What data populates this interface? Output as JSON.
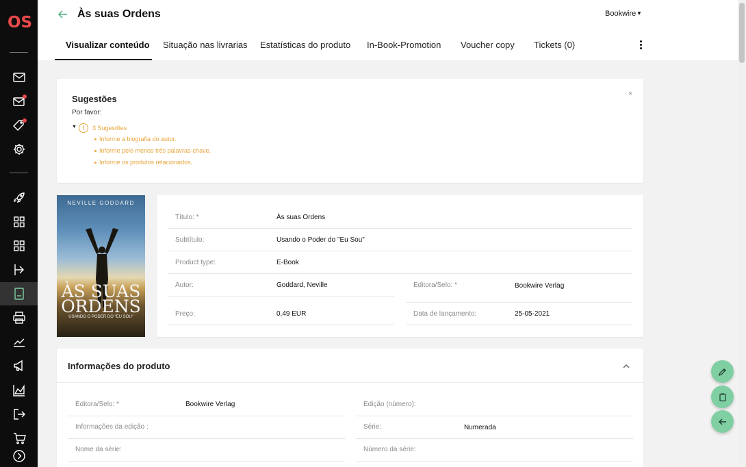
{
  "app": {
    "logo": "OS"
  },
  "header": {
    "title": "Às suas Ordens",
    "account": "Bookwire",
    "tabs": [
      {
        "label": "Visualizar conteúdo",
        "active": true
      },
      {
        "label": "Situação nas livrarias"
      },
      {
        "label": "Estatísticas do produto"
      },
      {
        "label": "In-Book-Promotion"
      },
      {
        "label": "Voucher copy"
      },
      {
        "label": "Tickets (0)"
      }
    ]
  },
  "sidebar": {
    "icons": [
      "mail-icon",
      "mail-notification-icon",
      "tag-notification-icon",
      "settings-icon",
      "rocket-icon",
      "grid-icon",
      "grid-secondary-icon",
      "import-icon",
      "ebook-icon",
      "print-icon",
      "chart-icon",
      "megaphone-icon",
      "area-chart-icon",
      "export-icon",
      "cart-icon",
      "chevron-right-circle-icon"
    ],
    "active": "ebook-icon"
  },
  "suggestions": {
    "title": "Sugestões",
    "subtitle": "Por favor:",
    "close": "×",
    "count_label": "3 Sugestões",
    "items": [
      "Informe a biografia do autor.",
      "Informe pelo menos três palavras-chave.",
      "Informe os produtos relacionados."
    ],
    "warning_color": "#e8a53c"
  },
  "cover": {
    "author": "NEVILLE GODDARD",
    "title_line1": "ÀS SUAS",
    "title_line2": "ORDENS",
    "subtitle": "USANDO O PODER DO \"EU SOU\""
  },
  "details": {
    "title_label": "Título: *",
    "title_value": "Às suas Ordens",
    "subtitle_label": "Subtítulo:",
    "subtitle_value": "Usando o Poder do \"Eu Sou\"",
    "product_type_label": "Product type:",
    "product_type_value": "E-Book",
    "author_label": "Autor:",
    "author_value": "Goddard, Neville",
    "publisher_label": "Editora/Selo: *",
    "publisher_value": "Bookwire Verlag",
    "price_label": "Preço:",
    "price_value": "0,49 EUR",
    "release_label": "Data de lançamento:",
    "release_value": "25-05-2021"
  },
  "product_info": {
    "title": "Informações do produto",
    "publisher_label": "Editora/Selo: *",
    "publisher_value": "Bookwire Verlag",
    "edition_number_label": "Edição (número):",
    "edition_info_label": "Informações da edição :",
    "series_label": "Série:",
    "series_value": "Numerada",
    "series_name_label": "Nome da série:",
    "series_number_label": "Número da série:"
  },
  "colors": {
    "accent": "#7fcfa3",
    "back_arrow": "#4caf7d",
    "logo": "#e84a4a"
  }
}
